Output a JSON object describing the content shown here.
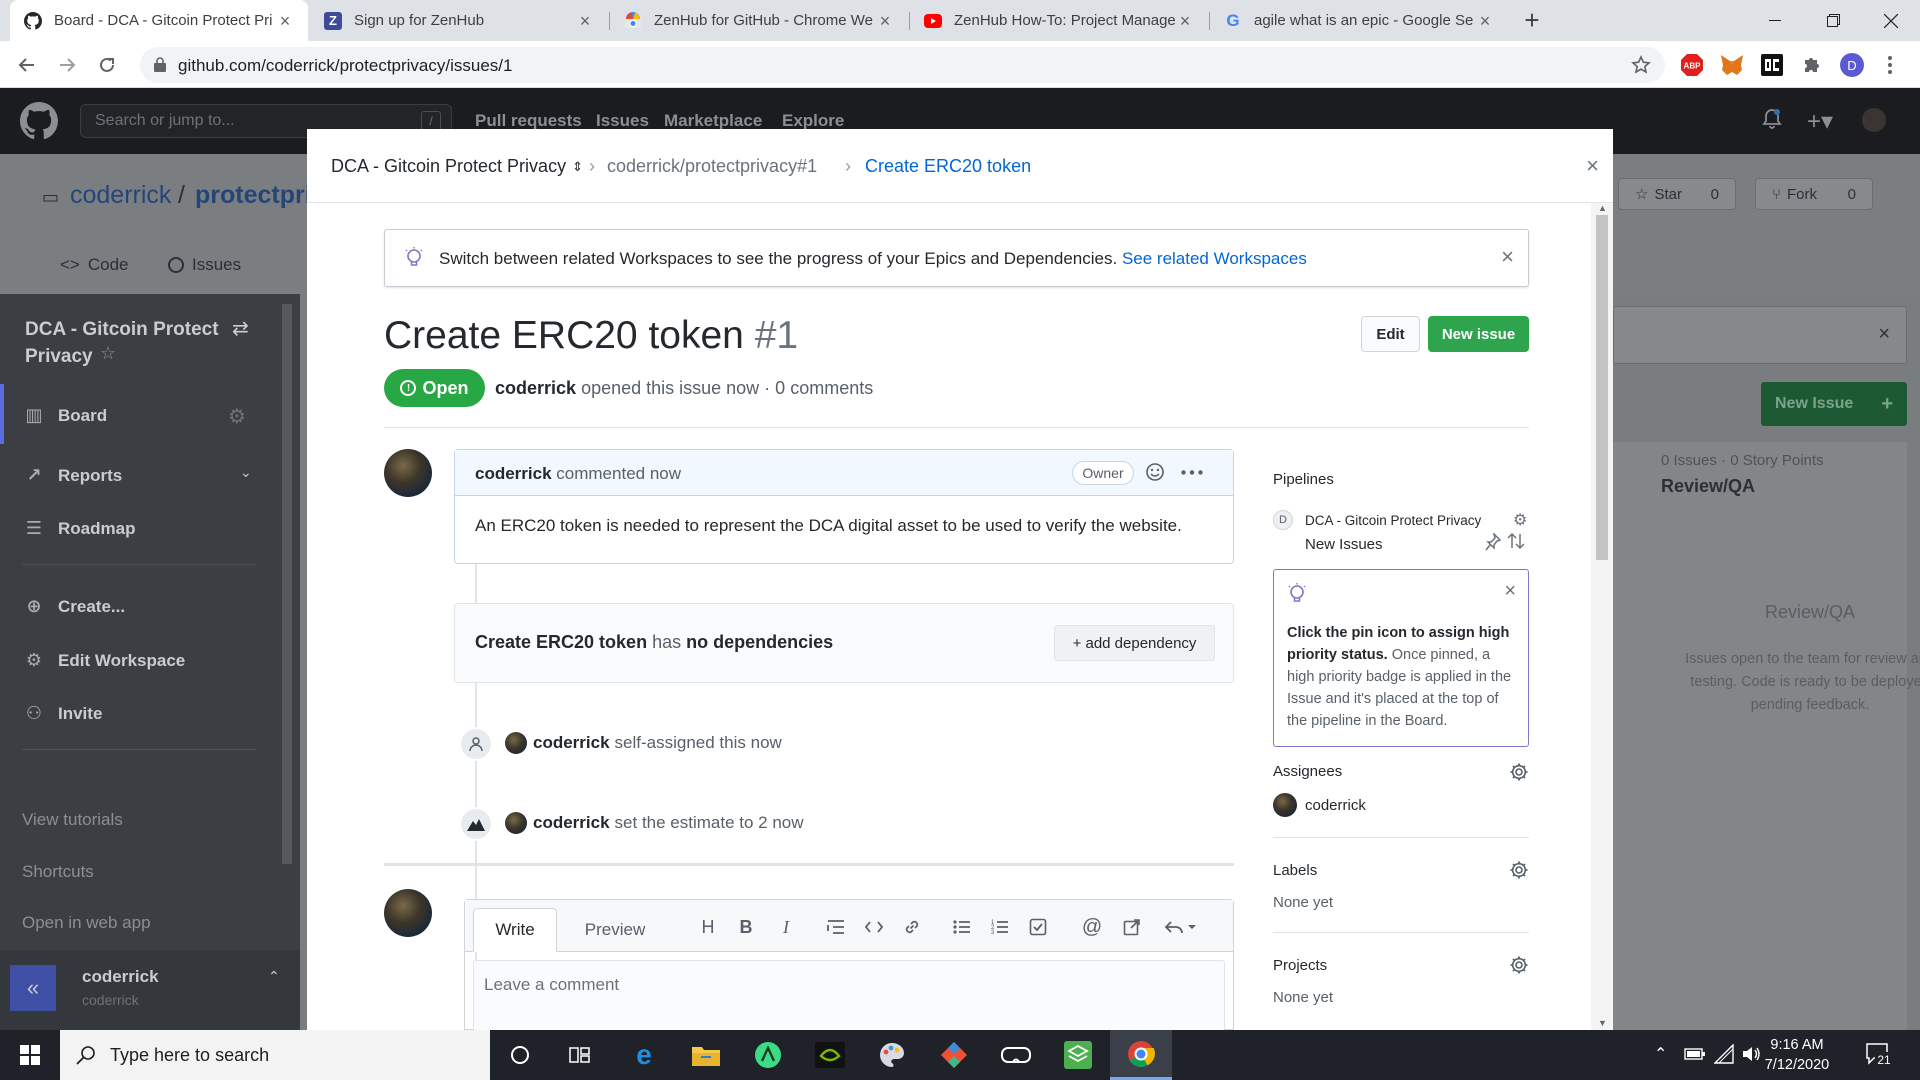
{
  "browser": {
    "tabs": [
      {
        "title": "Board - DCA - Gitcoin Protect Pri",
        "active": true
      },
      {
        "title": "Sign up for ZenHub"
      },
      {
        "title": "ZenHub for GitHub - Chrome We"
      },
      {
        "title": "ZenHub How-To: Project Manage"
      },
      {
        "title": "agile what is an epic - Google Se"
      }
    ],
    "url": "github.com/coderrick/protectprivacy/issues/1",
    "profile_initial": "D",
    "abp_label": "ABP"
  },
  "github_header": {
    "search_placeholder": "Search or jump to...",
    "search_hotkey": "/",
    "nav": [
      "Pull requests",
      "Issues",
      "Marketplace",
      "Explore"
    ]
  },
  "background": {
    "repo_owner": "coderrick",
    "repo_sep": "/",
    "repo_name": "protectpri",
    "repo_tabs": [
      "Code",
      "Issues"
    ],
    "star_label": "Star",
    "star_count": "0",
    "fork_label": "Fork",
    "fork_count": "0",
    "workspace_name": "DCA - Gitcoin Protect Privacy",
    "sidebar": {
      "board": "Board",
      "reports": "Reports",
      "roadmap": "Roadmap",
      "create": "Create...",
      "edit_workspace": "Edit Workspace",
      "invite": "Invite",
      "view_tutorials": "View tutorials",
      "shortcuts": "Shortcuts",
      "open_web_app": "Open in web app",
      "user_name": "coderrick",
      "user_login": "coderrick"
    },
    "board": {
      "new_issue": "New Issue",
      "column_stats": "0 Issues · 0 Story Points",
      "column_title": "Review/QA",
      "empty_title": "Review/QA",
      "empty_desc": "Issues open to the team for review and testing. Code is ready to be deployed pending feedback."
    }
  },
  "modal": {
    "breadcrumb": {
      "workspace": "DCA - Gitcoin Protect Privacy",
      "issue_ref": "coderrick/protectprivacy#1",
      "current": "Create ERC20 token"
    },
    "banner": {
      "prefix": "Switch between related Workspaces",
      "middle": " to see the progress of your ",
      "epics": "Epics",
      "and": " and ",
      "deps": "Dependencies.",
      "link": "See related Workspaces"
    },
    "title": "Create ERC20 token",
    "number": "#1",
    "edit_label": "Edit",
    "new_issue_label": "New issue",
    "status": "Open",
    "meta_author": "coderrick",
    "meta_rest": "opened this issue now · 0 comments",
    "comment": {
      "author": "coderrick",
      "action": "commented now",
      "role": "Owner",
      "body": "An ERC20 token is needed to represent the DCA digital asset to be used to verify the website."
    },
    "dependency": {
      "issue": "Create ERC20 token",
      "has": "has",
      "none": "no dependencies",
      "add_label": "+ add dependency"
    },
    "events": [
      {
        "actor": "coderrick",
        "text": "self-assigned this now"
      },
      {
        "actor": "coderrick",
        "text": "set the estimate to 2 now"
      }
    ],
    "editor": {
      "write_tab": "Write",
      "preview_tab": "Preview",
      "placeholder": "Leave a comment"
    },
    "sidebar": {
      "pipelines_label": "Pipelines",
      "workspace_initial": "D",
      "workspace": "DCA - Gitcoin Protect Privacy",
      "pipeline": "New Issues",
      "tip_bold": "Click the pin icon to assign high priority status.",
      "tip_rest": " Once pinned, a high priority badge is applied in the Issue and it's placed at the top of the pipeline in the Board.",
      "assignees_label": "Assignees",
      "assignee": "coderrick",
      "labels_label": "Labels",
      "labels_value": "None yet",
      "projects_label": "Projects",
      "projects_value": "None yet"
    }
  },
  "taskbar": {
    "search_placeholder": "Type here to search",
    "time": "9:16 AM",
    "date": "7/12/2020",
    "notification_count": "21"
  }
}
